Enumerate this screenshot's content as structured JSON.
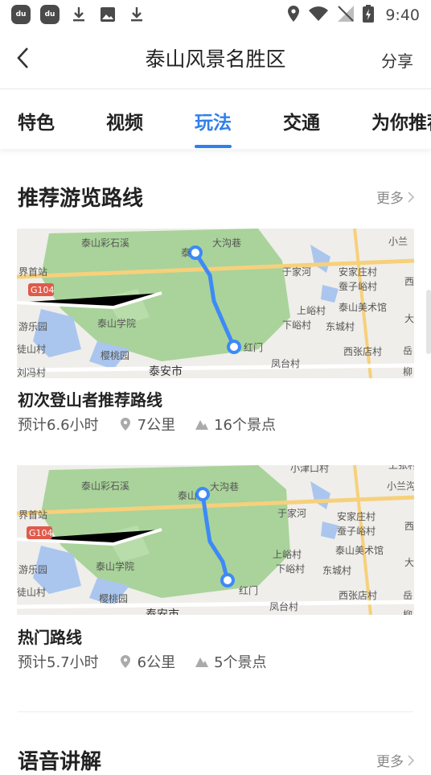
{
  "status_bar": {
    "time": "9:40",
    "app_icon_label": "du",
    "icons": [
      "du-app-icon",
      "du-app-icon",
      "download-icon",
      "image-icon",
      "download-icon",
      "location-icon",
      "wifi-icon",
      "no-signal-icon",
      "battery-icon"
    ]
  },
  "header": {
    "title": "泰山风景名胜区",
    "share_label": "分享"
  },
  "tabs": [
    {
      "label": "特色",
      "active": false
    },
    {
      "label": "视频",
      "active": false
    },
    {
      "label": "玩法",
      "active": true
    },
    {
      "label": "交通",
      "active": false
    },
    {
      "label": "为你推荐",
      "active": false
    }
  ],
  "routes_section": {
    "title": "推荐游览路线",
    "more_label": "更多",
    "routes": [
      {
        "name": "初次登山者推荐路线",
        "duration": "预计6.6小时",
        "distance": "7公里",
        "spots": "16个景点",
        "map_labels": [
          "泰山彩石溪",
          "泰",
          "大沟巷",
          "于家河",
          "安家庄村",
          "蚕子峪村",
          "上峪村",
          "泰山美术馆",
          "下峪村",
          "东城村",
          "界首站",
          "G104",
          "游乐园",
          "泰山学院",
          "红门",
          "西张店村",
          "徒山村",
          "樱桃园",
          "凤台村",
          "刘冯村",
          "泰安市",
          "小兰",
          "西",
          "大",
          "岳",
          "柳"
        ]
      },
      {
        "name": "热门路线",
        "duration": "预计5.7小时",
        "distance": "6公里",
        "spots": "5个景点",
        "map_labels": [
          "泰山彩石溪",
          "泰山",
          "大沟巷",
          "小津口村",
          "上张村",
          "小兰沟",
          "于家河",
          "安家庄村",
          "蚕子峪村",
          "西",
          "上峪村",
          "泰山美术馆",
          "大",
          "下峪村",
          "东城村",
          "界首站",
          "G104",
          "游乐园",
          "泰山学院",
          "红门",
          "西张店村",
          "岳",
          "徒山村",
          "樱桃园",
          "凤台村",
          "泰安市",
          "柳"
        ]
      }
    ]
  },
  "voice_section": {
    "title": "语音讲解",
    "more_label": "更多"
  },
  "colors": {
    "accent": "#2f80ed",
    "route_line": "#3d8af7",
    "park_green": "#a9d39a",
    "water": "#aac6ee",
    "map_bg": "#efeeea"
  }
}
